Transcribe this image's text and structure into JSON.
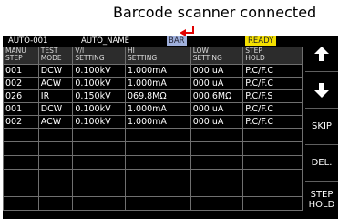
{
  "annotation": {
    "label": "Barcode scanner connected",
    "color": "#e00000"
  },
  "status_bar": {
    "test_no": "AUTO-001",
    "name": "AUTO_NAME",
    "bar_badge": "BAR",
    "ready_badge": "READY"
  },
  "table": {
    "headers": [
      [
        "MANU",
        "STEP"
      ],
      [
        "TEST",
        "MODE"
      ],
      [
        "V/I",
        "SETTING"
      ],
      [
        "HI",
        "SETTING"
      ],
      [
        "LOW",
        "SETTING"
      ],
      [
        "STEP",
        "HOLD"
      ]
    ],
    "rows": [
      [
        "001",
        "DCW",
        "0.100kV",
        "1.000mA",
        "000 uA",
        "P.C/F.C"
      ],
      [
        "002",
        "ACW",
        "0.100kV",
        "1.000mA",
        "000 uA",
        "P.C/F.C"
      ],
      [
        "026",
        "IR",
        "0.150kV",
        "069.8MΩ",
        "000.6MΩ",
        "P.C/F.S"
      ],
      [
        "001",
        "DCW",
        "0.100kV",
        "1.000mA",
        "000 uA",
        "P.C/F.C"
      ],
      [
        "002",
        "ACW",
        "0.100kV",
        "1.000mA",
        "000 uA",
        "P.C/F.C"
      ]
    ],
    "empty_row_count": 6
  },
  "side_buttons": {
    "up_icon": "arrow-up-icon",
    "down_icon": "arrow-down-icon",
    "skip": "SKIP",
    "delete": "DEL.",
    "step_hold_line1": "STEP",
    "step_hold_line2": "HOLD"
  }
}
